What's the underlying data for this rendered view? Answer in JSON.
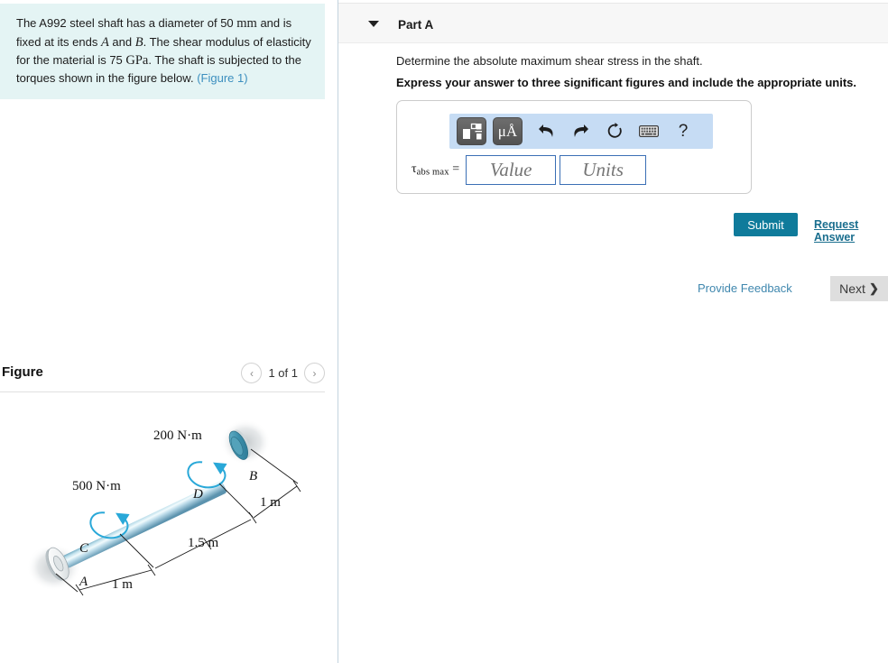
{
  "problem": {
    "text_part1": "The A992 steel shaft has a diameter of 50 ",
    "unit_mm": "mm",
    "text_part2": " and is fixed at its ends ",
    "var_a": "A",
    "text_and": " and ",
    "var_b": "B",
    "text_part3": ". The shear modulus of elasticity for the material is 75 ",
    "unit_gpa": "GPa",
    "text_part4": ". The shaft is subjected to the torques shown in the figure below.",
    "figure_link": "(Figure 1)"
  },
  "figure": {
    "title": "Figure",
    "counter": "1 of 1",
    "prev_icon": "chevron-left-icon",
    "next_icon": "chevron-right-icon",
    "prev_glyph": "‹",
    "next_glyph": "›",
    "labels": {
      "torque_left": "500 N·m",
      "torque_right": "200 N·m",
      "point_a": "A",
      "point_b": "B",
      "point_c": "C",
      "point_d": "D",
      "dim_ac": "1 m",
      "dim_cd": "1.5 m",
      "dim_db": "1 m"
    },
    "colors": {
      "shaft_light": "#eaf5fa",
      "shaft_mid": "#9ecbdd",
      "shaft_dark": "#5c9bb5",
      "flange_b": "#3f93ac",
      "flange_a": "#e9ecee",
      "torque_arrow": "#29a8d8"
    }
  },
  "part": {
    "title": "Part A",
    "toggle_icon": "triangle-down-icon",
    "question": "Determine the absolute maximum shear stress in the shaft.",
    "instruction": "Express your answer to three significant figures and include the appropriate units."
  },
  "answer": {
    "label_symbol": "τ",
    "label_sub": "abs max",
    "label_equals": "=",
    "value_placeholder": "Value",
    "units_placeholder": "Units",
    "value": "",
    "units": "",
    "toolbar": [
      {
        "name": "math-template-icon",
        "glyph": ""
      },
      {
        "name": "units-micro-angstrom-icon",
        "glyph": "μÅ"
      },
      {
        "name": "undo-icon",
        "glyph": "↩"
      },
      {
        "name": "redo-icon",
        "glyph": "↪"
      },
      {
        "name": "reset-icon",
        "glyph": "↻"
      },
      {
        "name": "keyboard-icon",
        "glyph": "⌨"
      },
      {
        "name": "help-icon",
        "glyph": "?"
      }
    ]
  },
  "actions": {
    "submit_label": "Submit",
    "request_answer_label": "Request Answer",
    "provide_feedback_label": "Provide Feedback",
    "next_label": "Next",
    "next_chevron": "❯"
  },
  "colors": {
    "info_box_bg": "#e4f4f4",
    "accent_teal": "#0f7b9b",
    "link_blue": "#3f87ae",
    "toolbar_bg": "#c6dcf4",
    "input_border": "#3b6fb5",
    "next_bg": "#dedede"
  }
}
